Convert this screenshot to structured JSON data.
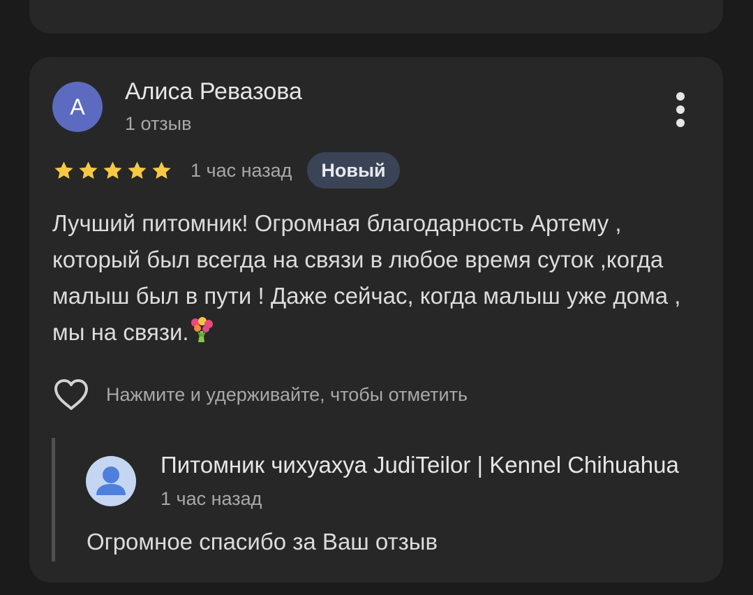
{
  "review": {
    "author_initial": "А",
    "author_name": "Алиса Ревазова",
    "author_meta": "1 отзыв",
    "rating": 5,
    "time": "1 час назад",
    "badge": "Новый",
    "text": "Лучший питомник! Огромная благодарность Артему , который был всегда на связи в любое время суток ,когда малыш был в пути ! Даже сейчас, когда малыш уже дома , мы на связи.",
    "emoji_icon": "bouquet-emoji",
    "like_hint": "Нажмите и удерживайте, чтобы отметить"
  },
  "reply": {
    "owner_name": "Питомник чихуахуа JudiTeilor | Kennel Chihuahua",
    "time": "1 час назад",
    "text": "Огромное спасибо за Ваш отзыв"
  },
  "colors": {
    "background": "#1b1b1b",
    "card": "#272727",
    "avatar": "#5c6bc0",
    "star": "#f6c944",
    "badge": "#3b4356",
    "owner_avatar": "#c4d6f2",
    "owner_avatar_figure": "#4e7fdc"
  }
}
